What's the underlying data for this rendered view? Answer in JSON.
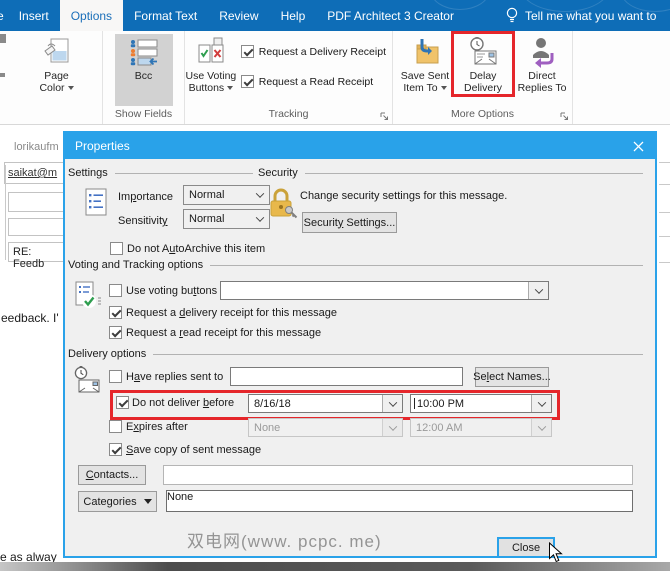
{
  "ribbon": {
    "tabs": [
      {
        "label": "e",
        "active": false
      },
      {
        "label": "Insert",
        "active": false
      },
      {
        "label": "Options",
        "active": true
      },
      {
        "label": "Format Text",
        "active": false
      },
      {
        "label": "Review",
        "active": false
      },
      {
        "label": "Help",
        "active": false
      },
      {
        "label": "PDF Architect 3 Creator",
        "active": false
      }
    ],
    "tell_me": "Tell me what you want to",
    "show_fields_group": {
      "label": "Show Fields",
      "page_color_line1": "Page",
      "page_color_line2": "Color",
      "bcc_label": "Bcc"
    },
    "tracking_group": {
      "label": "Tracking",
      "use_voting_line1": "Use Voting",
      "use_voting_line2": "Buttons",
      "delivery_receipt_label": "Request a Delivery Receipt",
      "delivery_receipt_checked": true,
      "read_receipt_label": "Request a Read Receipt",
      "read_receipt_checked": true
    },
    "more_options_group": {
      "label": "More Options",
      "save_sent_line1": "Save Sent",
      "save_sent_line2": "Item To",
      "delay_line1": "Delay",
      "delay_line2": "Delivery",
      "direct_line1": "Direct",
      "direct_line2": "Replies To"
    }
  },
  "background": {
    "from_fragment": "lorikaufm",
    "to_fragment": "saikat@m",
    "subject_fragment": "RE: Feedb",
    "body_fragment": "eedback. I'",
    "bottom_fragment": "e as alway"
  },
  "dialog": {
    "title": "Properties",
    "settings": {
      "group_label": "Settings",
      "importance_label": "Im[p]ortance",
      "importance_value": "Normal",
      "sensitivity_label": "Sensitivit[y]",
      "sensitivity_value": "Normal",
      "autoarchive_label": "Do not A[u]toArchive this item",
      "autoarchive_checked": false
    },
    "security": {
      "group_label": "Security",
      "description": "Change security settings for this message.",
      "button_label": "Securit[y] Settings..."
    },
    "voting": {
      "group_label": "Voting and Tracking options",
      "use_voting_label": "Use voting bu[t]tons",
      "use_voting_checked": false,
      "use_voting_value": "",
      "delivery_receipt_label": "Request a [d]elivery receipt for this message",
      "delivery_receipt_checked": true,
      "read_receipt_label": "Request a [r]ead receipt for this message",
      "read_receipt_checked": true
    },
    "delivery": {
      "group_label": "Delivery options",
      "have_replies_label": "H[a]ve replies sent to",
      "have_replies_checked": false,
      "have_replies_value": "",
      "select_names_button": "Se[l]ect Names...",
      "do_not_deliver_label": "Do not deliver [b]efore",
      "do_not_deliver_checked": true,
      "deliver_date": "8/16/18",
      "deliver_time": "10:00 PM",
      "expires_label": "E[x]pires after",
      "expires_checked": false,
      "expires_date": "None",
      "expires_time": "12:00 AM",
      "save_copy_label": "[S]ave copy of sent message",
      "save_copy_checked": true
    },
    "contacts_button": "[C]ontacts...",
    "contacts_value": "",
    "categories_button": "Cate[g]ories",
    "categories_value": "None",
    "close_button": "Close"
  },
  "watermark": "双电网(www. pcpc. me)",
  "colors": {
    "ribbon_blue": "#0e6db7",
    "dialog_titlebar_blue": "#29a2e9",
    "highlight_red": "#e5262b",
    "bcc_pressed_gray": "#d2d2d2"
  }
}
